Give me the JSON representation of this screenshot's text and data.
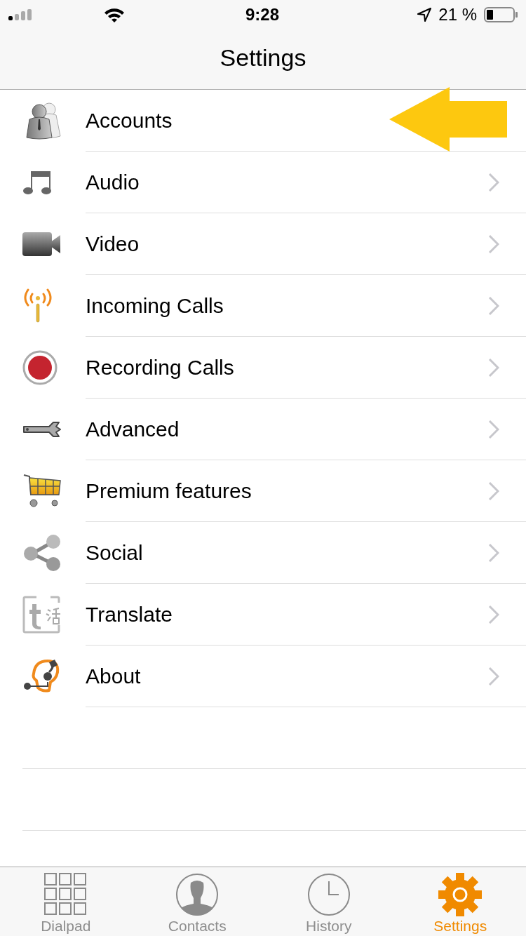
{
  "status_bar": {
    "time": "9:28",
    "battery": "21 %"
  },
  "nav": {
    "title": "Settings"
  },
  "items": [
    {
      "label": "Accounts",
      "kind": "accounts",
      "pointed": true
    },
    {
      "label": "Audio",
      "kind": "audio",
      "pointed": false
    },
    {
      "label": "Video",
      "kind": "video",
      "pointed": false
    },
    {
      "label": "Incoming Calls",
      "kind": "incoming",
      "pointed": false
    },
    {
      "label": "Recording Calls",
      "kind": "recording",
      "pointed": false
    },
    {
      "label": "Advanced",
      "kind": "advanced",
      "pointed": false
    },
    {
      "label": "Premium features",
      "kind": "premium",
      "pointed": false
    },
    {
      "label": "Social",
      "kind": "social",
      "pointed": false
    },
    {
      "label": "Translate",
      "kind": "translate",
      "pointed": false
    },
    {
      "label": "About",
      "kind": "about",
      "pointed": false
    }
  ],
  "tabs": [
    {
      "label": "Dialpad",
      "kind": "dialpad",
      "selected": false
    },
    {
      "label": "Contacts",
      "kind": "contacts",
      "selected": false
    },
    {
      "label": "History",
      "kind": "history",
      "selected": false
    },
    {
      "label": "Settings",
      "kind": "settings",
      "selected": true
    }
  ]
}
